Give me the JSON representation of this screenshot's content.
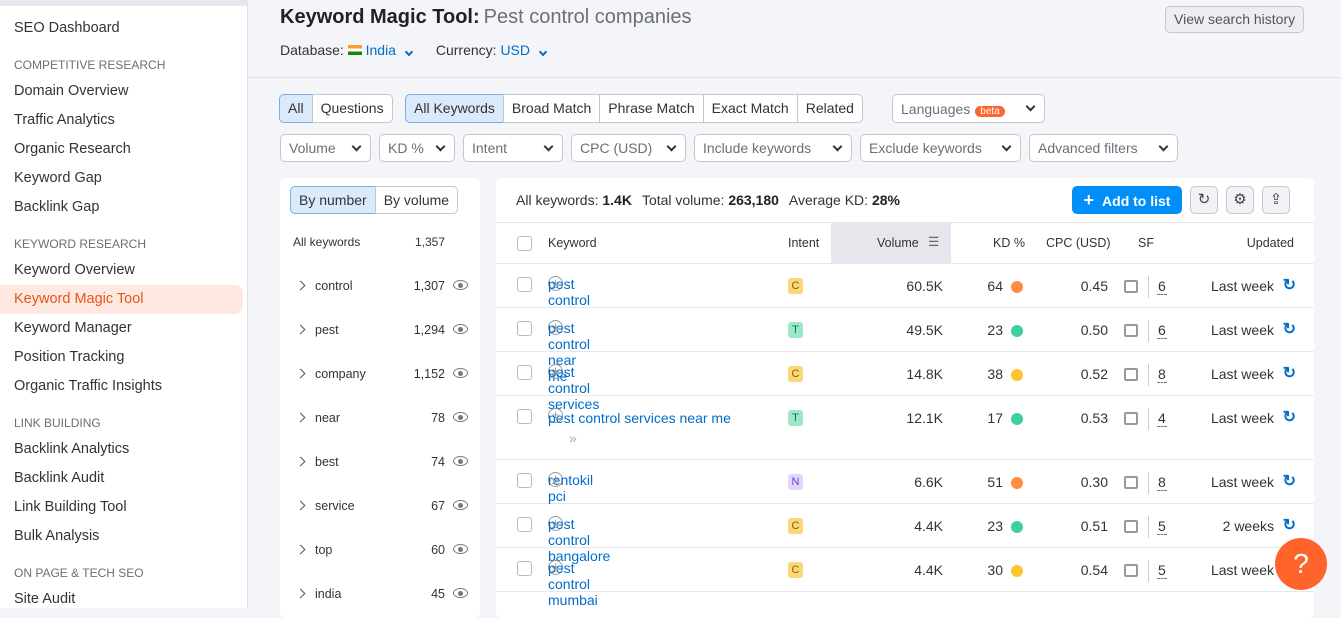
{
  "sidebar": {
    "items": [
      {
        "type": "item",
        "label": "SEO Dashboard"
      },
      {
        "type": "section",
        "label": "COMPETITIVE RESEARCH"
      },
      {
        "type": "item",
        "label": "Domain Overview"
      },
      {
        "type": "item",
        "label": "Traffic Analytics"
      },
      {
        "type": "item",
        "label": "Organic Research"
      },
      {
        "type": "item",
        "label": "Keyword Gap"
      },
      {
        "type": "item",
        "label": "Backlink Gap"
      },
      {
        "type": "section",
        "label": "KEYWORD RESEARCH"
      },
      {
        "type": "item",
        "label": "Keyword Overview"
      },
      {
        "type": "item",
        "label": "Keyword Magic Tool",
        "active": true
      },
      {
        "type": "item",
        "label": "Keyword Manager"
      },
      {
        "type": "item",
        "label": "Position Tracking"
      },
      {
        "type": "item",
        "label": "Organic Traffic Insights"
      },
      {
        "type": "section",
        "label": "LINK BUILDING"
      },
      {
        "type": "item",
        "label": "Backlink Analytics"
      },
      {
        "type": "item",
        "label": "Backlink Audit"
      },
      {
        "type": "item",
        "label": "Link Building Tool"
      },
      {
        "type": "item",
        "label": "Bulk Analysis"
      },
      {
        "type": "section",
        "label": "ON PAGE & TECH SEO"
      },
      {
        "type": "item",
        "label": "Site Audit"
      }
    ]
  },
  "header": {
    "title": "Keyword Magic Tool:",
    "query": "Pest control companies",
    "database_label": "Database:",
    "database": "India",
    "currency_label": "Currency:",
    "currency": "USD",
    "history": "View search history"
  },
  "tabs1": [
    "All",
    "Questions"
  ],
  "tabs2": [
    "All Keywords",
    "Broad Match",
    "Phrase Match",
    "Exact Match",
    "Related"
  ],
  "languages": {
    "label": "Languages",
    "badge": "beta"
  },
  "filters": [
    "Volume",
    "KD %",
    "Intent",
    "CPC (USD)",
    "Include keywords",
    "Exclude keywords",
    "Advanced filters"
  ],
  "groups": {
    "tabs": [
      "By number",
      "By volume"
    ],
    "all_label": "All keywords",
    "all_count": "1,357",
    "items": [
      {
        "label": "control",
        "count": "1,307"
      },
      {
        "label": "pest",
        "count": "1,294"
      },
      {
        "label": "company",
        "count": "1,152"
      },
      {
        "label": "near",
        "count": "78"
      },
      {
        "label": "best",
        "count": "74"
      },
      {
        "label": "service",
        "count": "67"
      },
      {
        "label": "top",
        "count": "60"
      },
      {
        "label": "india",
        "count": "45"
      }
    ]
  },
  "summary": {
    "all_label": "All keywords:",
    "all": "1.4K",
    "total_label": "Total volume:",
    "total": "263,180",
    "kd_label": "Average KD:",
    "kd": "28%"
  },
  "add_to_list": "Add to list",
  "columns": [
    "Keyword",
    "Intent",
    "Volume",
    "KD %",
    "CPC (USD)",
    "SF",
    "Updated"
  ],
  "colors": {
    "C": "#fcd679",
    "T": "#9ee7c9",
    "N": "#e3d6fc",
    "orange": "#ff8c40",
    "green": "#3fd19b",
    "yellow": "#ffc42d",
    "accent": "#008ff8",
    "brand": "#ff642d"
  },
  "rows": [
    {
      "kw": "pest control",
      "intent": "C",
      "vol": "60.5K",
      "kd": "64",
      "kdc": "orange",
      "cpc": "0.45",
      "sf": "6",
      "upd": "Last week"
    },
    {
      "kw": "pest control near me",
      "intent": "T",
      "vol": "49.5K",
      "kd": "23",
      "kdc": "green",
      "cpc": "0.50",
      "sf": "6",
      "upd": "Last week"
    },
    {
      "kw": "pest control services",
      "intent": "C",
      "vol": "14.8K",
      "kd": "38",
      "kdc": "yellow",
      "cpc": "0.52",
      "sf": "8",
      "upd": "Last week"
    },
    {
      "kw": "pest control services near me",
      "intent": "T",
      "vol": "12.1K",
      "kd": "17",
      "kdc": "green",
      "cpc": "0.53",
      "sf": "4",
      "upd": "Last week",
      "tall": true
    },
    {
      "kw": "rentokil pci",
      "intent": "N",
      "vol": "6.6K",
      "kd": "51",
      "kdc": "orange",
      "cpc": "0.30",
      "sf": "8",
      "upd": "Last week"
    },
    {
      "kw": "pest control bangalore",
      "intent": "C",
      "vol": "4.4K",
      "kd": "23",
      "kdc": "green",
      "cpc": "0.51",
      "sf": "5",
      "upd": "2 weeks"
    },
    {
      "kw": "pest control mumbai",
      "intent": "C",
      "vol": "4.4K",
      "kd": "30",
      "kdc": "yellow",
      "cpc": "0.54",
      "sf": "5",
      "upd": "Last week"
    }
  ],
  "help": "?"
}
